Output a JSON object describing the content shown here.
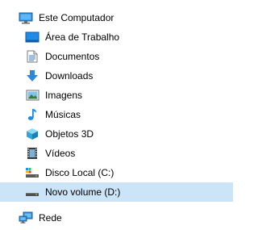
{
  "tree": {
    "root": {
      "label": "Este Computador",
      "icon": "computer-icon"
    },
    "items": [
      {
        "label": "Área de Trabalho",
        "icon": "desktop-icon"
      },
      {
        "label": "Documentos",
        "icon": "documents-icon"
      },
      {
        "label": "Downloads",
        "icon": "downloads-icon"
      },
      {
        "label": "Imagens",
        "icon": "pictures-icon"
      },
      {
        "label": "Músicas",
        "icon": "music-icon"
      },
      {
        "label": "Objetos 3D",
        "icon": "objects-3d-icon"
      },
      {
        "label": "Vídeos",
        "icon": "videos-icon"
      },
      {
        "label": "Disco Local (C:)",
        "icon": "local-disk-icon"
      },
      {
        "label": "Novo volume (D:)",
        "icon": "drive-icon",
        "selected": true
      }
    ],
    "network": {
      "label": "Rede",
      "icon": "network-icon"
    }
  },
  "colors": {
    "selection": "#cce4f7",
    "accent": "#1e90ff"
  }
}
